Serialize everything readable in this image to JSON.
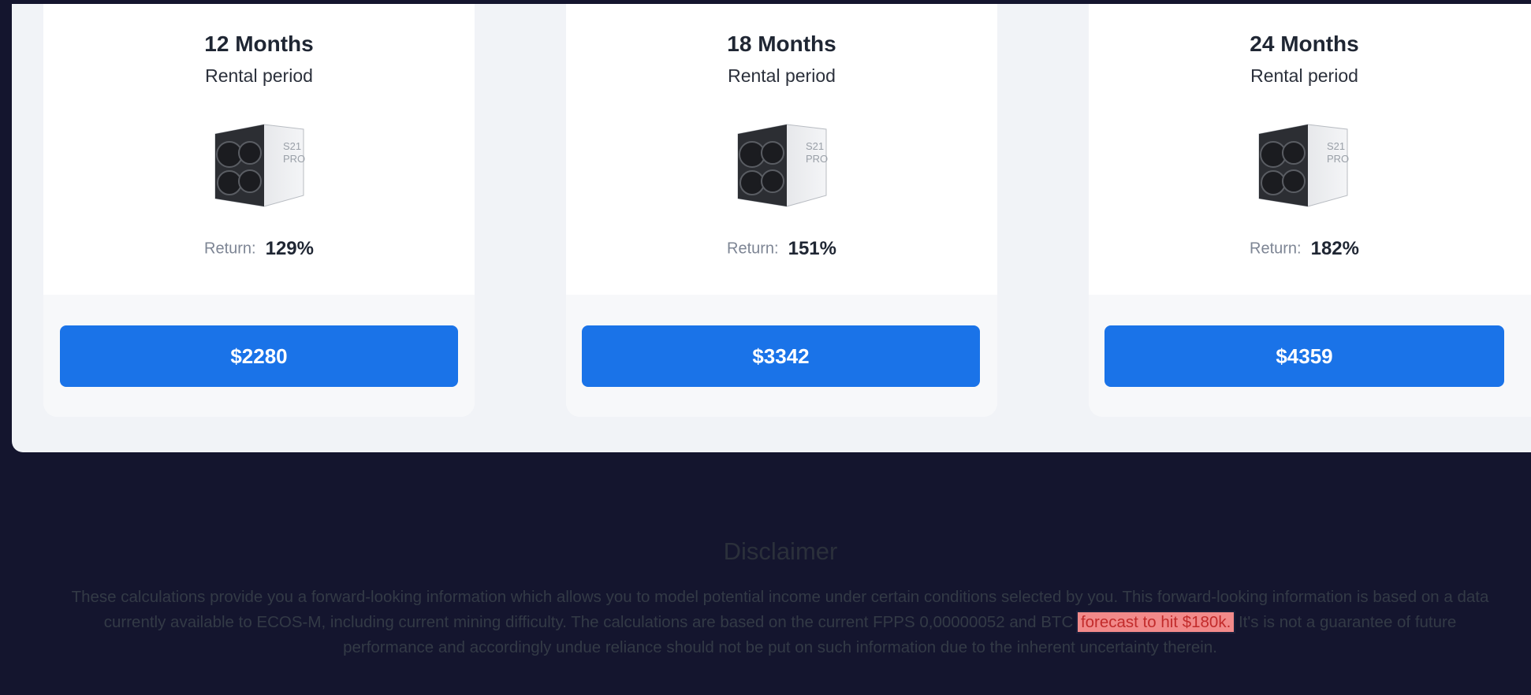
{
  "plans": [
    {
      "months_label": "12 Months",
      "period_label": "Rental period",
      "return_label": "Return:",
      "return_value": "129%",
      "price": "$2280"
    },
    {
      "months_label": "18 Months",
      "period_label": "Rental period",
      "return_label": "Return:",
      "return_value": "151%",
      "price": "$3342"
    },
    {
      "months_label": "24 Months",
      "period_label": "Rental period",
      "return_label": "Return:",
      "return_value": "182%",
      "price": "$4359"
    }
  ],
  "miner_model": {
    "line1": "S21",
    "line2": "PRO"
  },
  "disclaimer": {
    "title": "Disclaimer",
    "text_before": "These calculations provide you a forward-looking information which allows you to model potential income under certain conditions selected by you. This forward-looking information is based on a data currently available to ECOS-M, including current mining difficulty. The calculations are based on the current FPPS 0,00000052 and BTC",
    "highlighted": "forecast to hit $180k.",
    "text_after": "It's is not a guarantee of future performance and accordingly undue reliance should not be put on such information due to the inherent uncertainty therein."
  },
  "colors": {
    "accent": "#1a73e8",
    "highlight": "#f28a8a",
    "background": "#14152e"
  }
}
